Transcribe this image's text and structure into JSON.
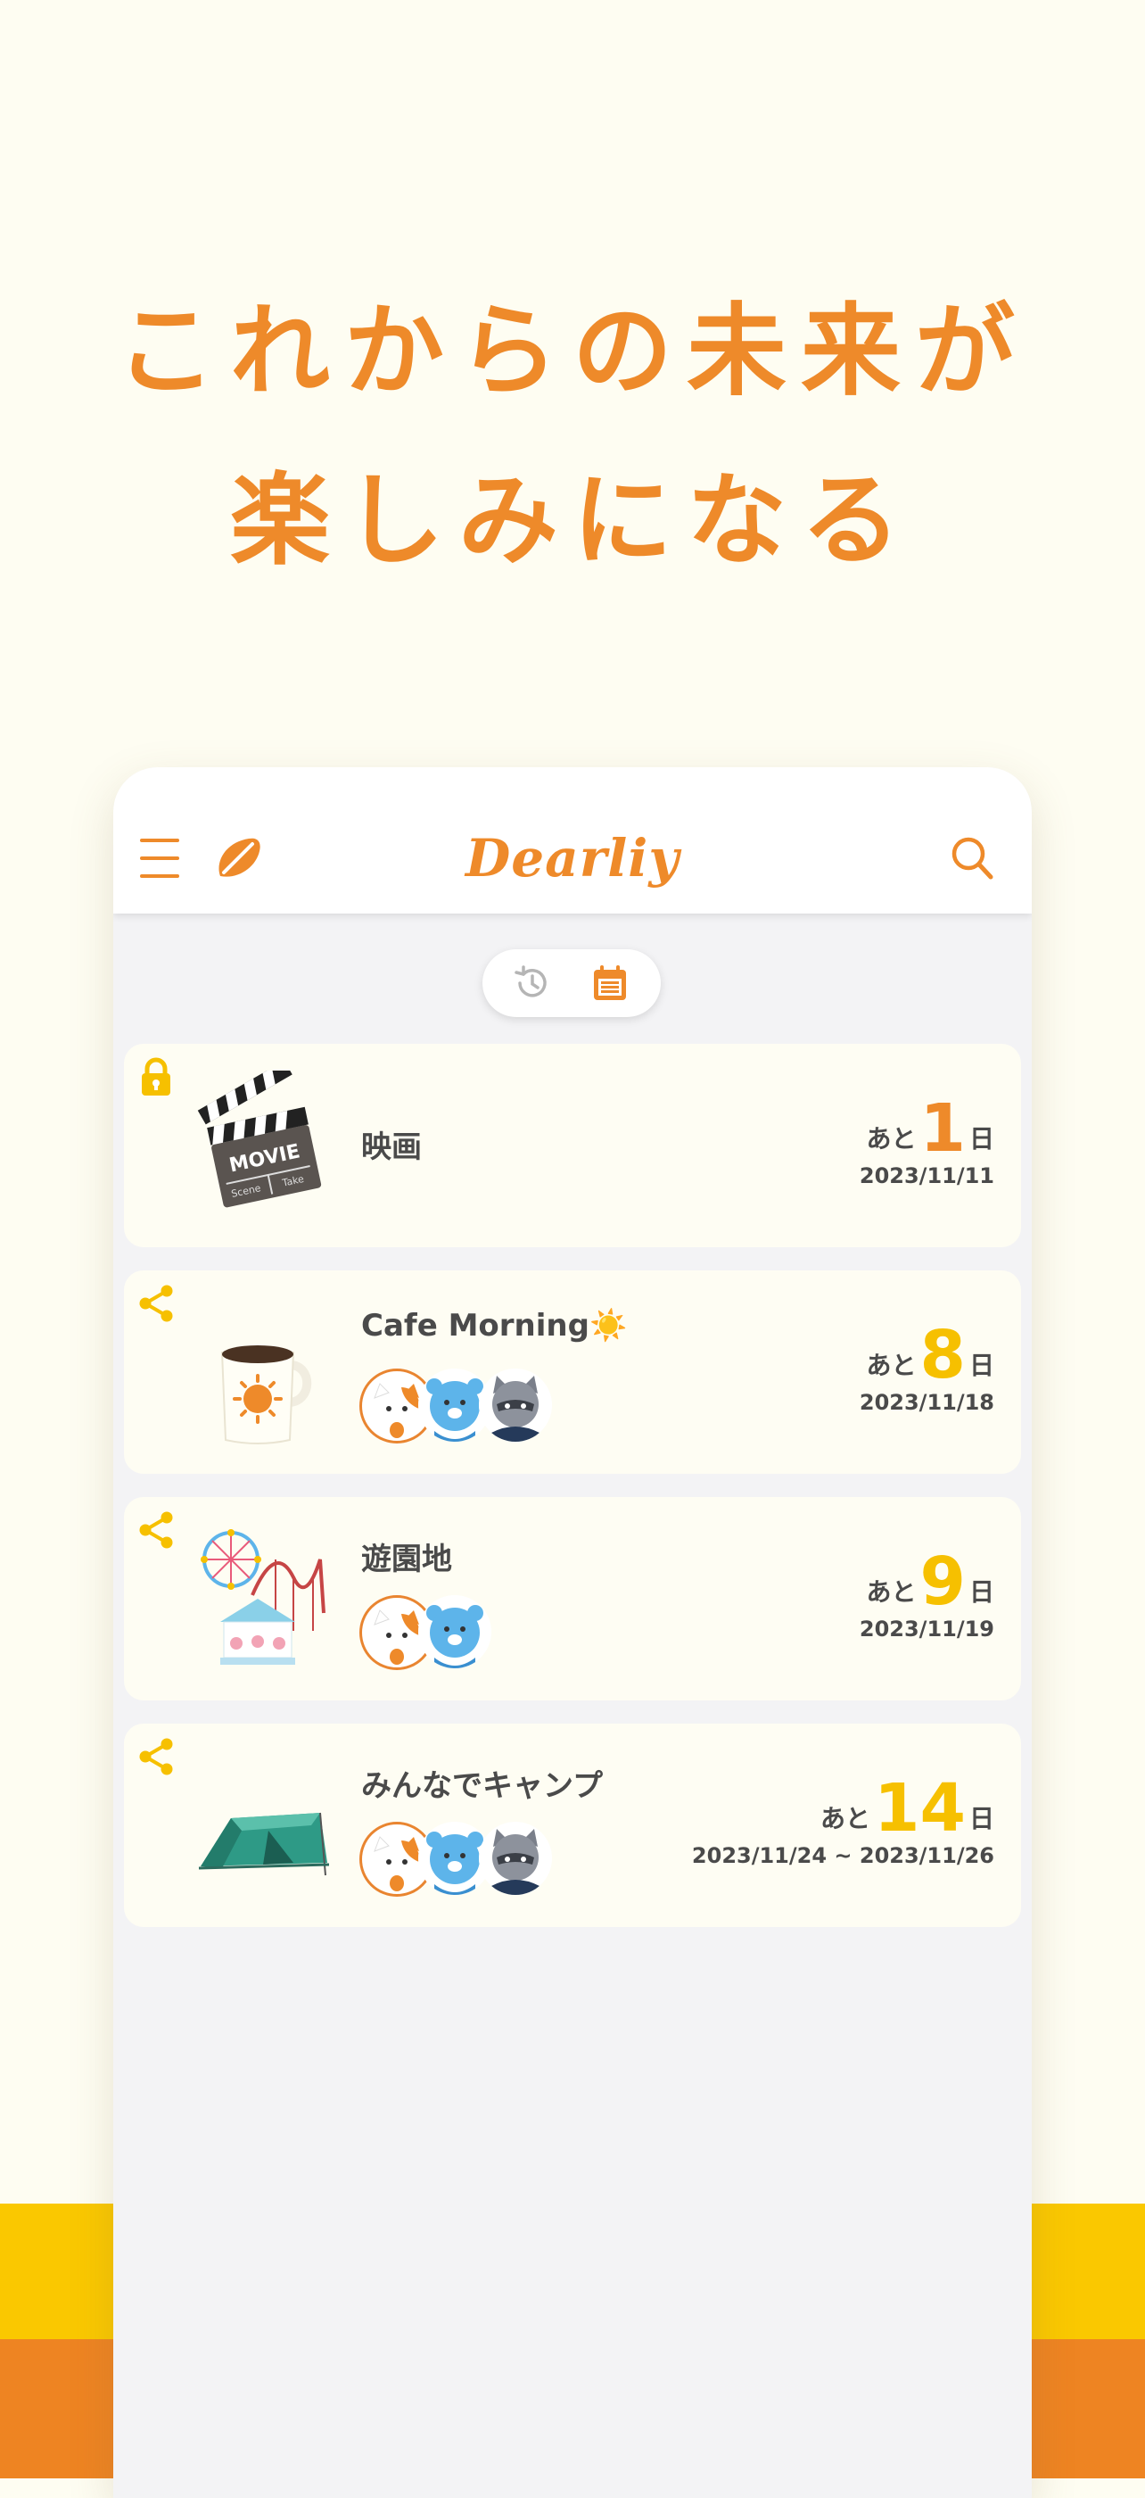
{
  "headline": {
    "line1": "これからの未来が",
    "line2": "楽しみになる"
  },
  "app": {
    "logo": "Dearliy"
  },
  "icons": {
    "menu": "menu-icon",
    "leaf": "leaf-icon",
    "search": "search-icon",
    "history": "history-icon",
    "calendar": "calendar-icon",
    "lock": "lock-icon",
    "share": "share-icon"
  },
  "colors": {
    "accent": "#ee8a2a",
    "highlight": "#fac800",
    "background": "#fefdf2",
    "list_bg": "#f3f3f5",
    "text": "#4a4a4a"
  },
  "events": [
    {
      "title": "映画",
      "badge": "lock",
      "image": "movie-clapperboard",
      "prefix": "あと",
      "days": "1",
      "suffix": "日",
      "date": "2023/11/11",
      "num_color": "#ee8a2a",
      "members": []
    },
    {
      "title": "Cafe Morning☀️",
      "badge": "share",
      "image": "coffee-mug",
      "prefix": "あと",
      "days": "8",
      "suffix": "日",
      "date": "2023/11/18",
      "num_color": "#f6c000",
      "members": [
        "cat",
        "blue-bear",
        "raccoon"
      ]
    },
    {
      "title": "遊園地",
      "badge": "share",
      "image": "amusement-park",
      "prefix": "あと",
      "days": "9",
      "suffix": "日",
      "date": "2023/11/19",
      "num_color": "#f6c000",
      "members": [
        "cat",
        "blue-bear"
      ]
    },
    {
      "title": "みんなでキャンプ",
      "badge": "share",
      "image": "camping-tent",
      "prefix": "あと",
      "days": "14",
      "suffix": "日",
      "date": "2023/11/24 ~ 2023/11/26",
      "num_color": "#f6c000",
      "members": [
        "cat",
        "blue-bear",
        "raccoon"
      ]
    }
  ]
}
